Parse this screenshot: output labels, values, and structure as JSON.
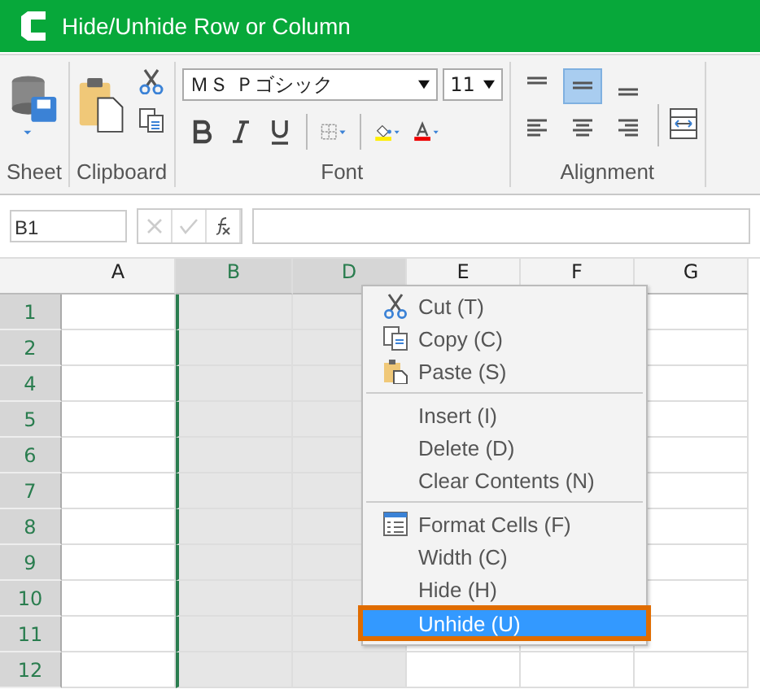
{
  "window": {
    "title": "Hide/Unhide Row or Column"
  },
  "ribbon": {
    "groups": [
      {
        "kind": "sheet",
        "label": "Sheet"
      },
      {
        "kind": "clipboard",
        "label": "Clipboard"
      },
      {
        "kind": "font",
        "label": "Font",
        "font_name": "ＭＳ Ｐゴシック",
        "font_size": "11"
      },
      {
        "kind": "alignment",
        "label": "Alignment",
        "vertical_selected": [
          false,
          true,
          false
        ]
      }
    ]
  },
  "formula_bar": {
    "name_box": "B1"
  },
  "sheet": {
    "columns": [
      {
        "label": "A",
        "selected": false
      },
      {
        "label": "B",
        "selected": true
      },
      {
        "label": "D",
        "selected": true
      },
      {
        "label": "E",
        "selected": false
      },
      {
        "label": "F",
        "selected": false
      },
      {
        "label": "G",
        "selected": false
      }
    ],
    "rows": [
      "1",
      "2",
      "4",
      "5",
      "6",
      "7",
      "8",
      "9",
      "10",
      "11",
      "12"
    ]
  },
  "context_menu": {
    "items": [
      {
        "label": "Cut (T)",
        "kind": "cut",
        "separator_before": false,
        "selected": false
      },
      {
        "label": "Copy (C)",
        "kind": "copy",
        "separator_before": false,
        "selected": false
      },
      {
        "label": "Paste (S)",
        "kind": "paste",
        "separator_before": false,
        "selected": false
      },
      {
        "label": "Insert (I)",
        "kind": "plain",
        "separator_before": true,
        "selected": false
      },
      {
        "label": "Delete (D)",
        "kind": "plain",
        "separator_before": false,
        "selected": false
      },
      {
        "label": "Clear Contents (N)",
        "kind": "plain",
        "separator_before": false,
        "selected": false
      },
      {
        "label": "Format Cells (F)",
        "kind": "format",
        "separator_before": true,
        "selected": false
      },
      {
        "label": "Width (C)",
        "kind": "plain",
        "separator_before": false,
        "selected": false
      },
      {
        "label": "Hide (H)",
        "kind": "plain",
        "separator_before": false,
        "selected": false
      },
      {
        "label": "Unhide (U)",
        "kind": "plain",
        "separator_before": false,
        "selected": true
      }
    ]
  }
}
